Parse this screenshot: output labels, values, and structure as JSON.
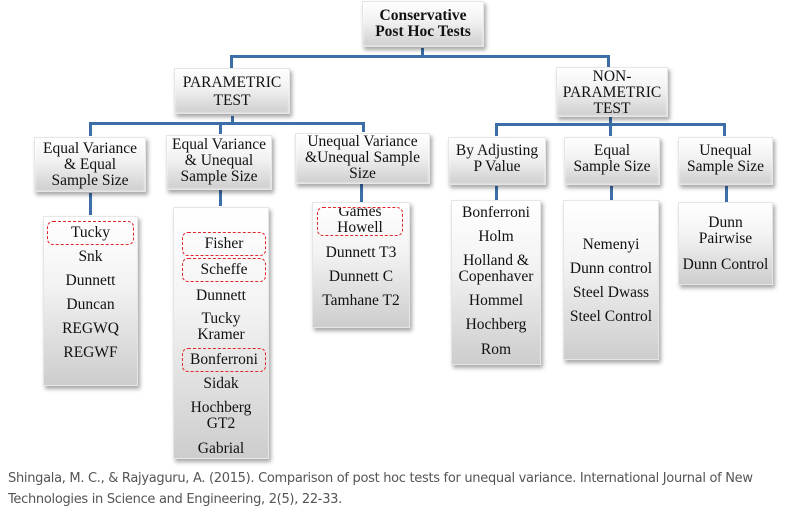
{
  "root": {
    "lines": [
      "Conservative",
      "Post Hoc Tests"
    ]
  },
  "branches": [
    {
      "label": [
        "PARAMETRIC",
        "TEST"
      ],
      "groups": [
        {
          "label": [
            "Equal Variance",
            "& Equal",
            "Sample Size"
          ],
          "tests": [
            {
              "name": "Tucky",
              "highlighted": true
            },
            {
              "name": "Snk",
              "highlighted": false
            },
            {
              "name": "Dunnett",
              "highlighted": false
            },
            {
              "name": "Duncan",
              "highlighted": false
            },
            {
              "name": "REGWQ",
              "highlighted": false
            },
            {
              "name": "REGWF",
              "highlighted": false
            }
          ]
        },
        {
          "label": [
            "Equal Variance",
            "& Unequal",
            "Sample Size"
          ],
          "tests": [
            {
              "name": "Fisher",
              "highlighted": true
            },
            {
              "name": "Scheffe",
              "highlighted": true
            },
            {
              "name": "Dunnett",
              "highlighted": false
            },
            {
              "name": "Tucky Kramer",
              "lines": [
                "Tucky",
                "Kramer"
              ],
              "highlighted": false
            },
            {
              "name": "Bonferroni",
              "highlighted": true
            },
            {
              "name": "Sidak",
              "highlighted": false
            },
            {
              "name": "Hochberg GT2",
              "lines": [
                "Hochberg",
                "GT2"
              ],
              "highlighted": false
            },
            {
              "name": "Gabrial",
              "highlighted": false
            }
          ]
        },
        {
          "label": [
            "Unequal Variance",
            "&Unequal Sample",
            "Size"
          ],
          "tests": [
            {
              "name": "Games Howell",
              "lines": [
                "Games",
                "Howell"
              ],
              "highlighted": true
            },
            {
              "name": "Dunnett T3",
              "highlighted": false
            },
            {
              "name": "Dunnett C",
              "highlighted": false
            },
            {
              "name": "Tamhane T2",
              "highlighted": false
            }
          ]
        }
      ]
    },
    {
      "label": [
        "NON-",
        "PARAMETRIC",
        "TEST"
      ],
      "groups": [
        {
          "label": [
            "By Adjusting",
            "P Value"
          ],
          "tests": [
            {
              "name": "Bonferroni",
              "highlighted": false
            },
            {
              "name": "Holm",
              "highlighted": false
            },
            {
              "name": "Holland & Copenhaver",
              "lines": [
                "Holland &",
                "Copenhaver"
              ],
              "highlighted": false
            },
            {
              "name": "Hommel",
              "highlighted": false
            },
            {
              "name": "Hochberg",
              "highlighted": false
            },
            {
              "name": "Rom",
              "highlighted": false
            }
          ]
        },
        {
          "label": [
            "Equal",
            "Sample Size"
          ],
          "tests": [
            {
              "name": "Nemenyi",
              "highlighted": false
            },
            {
              "name": "Dunn control",
              "highlighted": false
            },
            {
              "name": "Steel Dwass",
              "highlighted": false
            },
            {
              "name": "Steel Control",
              "highlighted": false
            }
          ]
        },
        {
          "label": [
            "Unequal",
            "Sample Size"
          ],
          "tests": [
            {
              "name": "Dunn Pairwise",
              "lines": [
                "Dunn",
                "Pairwise"
              ],
              "highlighted": false
            },
            {
              "name": "Dunn Control",
              "highlighted": false
            }
          ]
        }
      ]
    }
  ],
  "colors": {
    "connector": "#3c6ea8",
    "highlight": "#e0262b"
  },
  "caption": "Shingala, M. C., & Rajyaguru, A. (2015). Comparison of post hoc tests for unequal variance. International Journal of New Technologies in Science and Engineering, 2(5), 22-33."
}
